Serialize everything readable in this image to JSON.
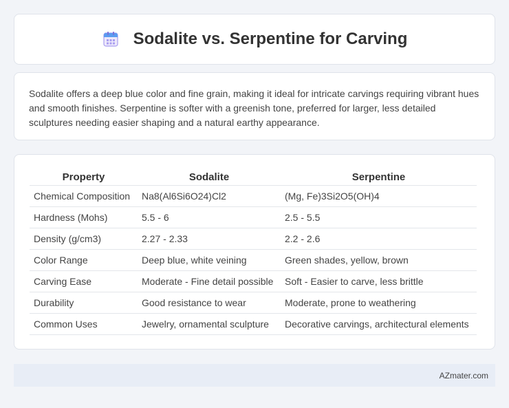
{
  "header": {
    "title": "Sodalite vs. Serpentine for Carving",
    "icon": "calendar-icon"
  },
  "description": {
    "text": "Sodalite offers a deep blue color and fine grain, making it ideal for intricate carvings requiring vibrant hues and smooth finishes. Serpentine is softer with a greenish tone, preferred for larger, less detailed sculptures needing easier shaping and a natural earthy appearance."
  },
  "table": {
    "headers": [
      "Property",
      "Sodalite",
      "Serpentine"
    ],
    "rows": [
      [
        "Chemical Composition",
        "Na8(Al6Si6O24)Cl2",
        "(Mg, Fe)3Si2O5(OH)4"
      ],
      [
        "Hardness (Mohs)",
        "5.5 - 6",
        "2.5 - 5.5"
      ],
      [
        "Density (g/cm3)",
        "2.27 - 2.33",
        "2.2 - 2.6"
      ],
      [
        "Color Range",
        "Deep blue, white veining",
        "Green shades, yellow, brown"
      ],
      [
        "Carving Ease",
        "Moderate - Fine detail possible",
        "Soft - Easier to carve, less brittle"
      ],
      [
        "Durability",
        "Good resistance to wear",
        "Moderate, prone to weathering"
      ],
      [
        "Common Uses",
        "Jewelry, ornamental sculpture",
        "Decorative carvings, architectural elements"
      ]
    ]
  },
  "footer": {
    "text": "AZmater.com"
  },
  "colors": {
    "background": "#f2f4f8",
    "card": "#ffffff",
    "footer": "#e8edf6",
    "icon_purple": "#7b6fd6",
    "icon_blue": "#5b9bf0"
  }
}
